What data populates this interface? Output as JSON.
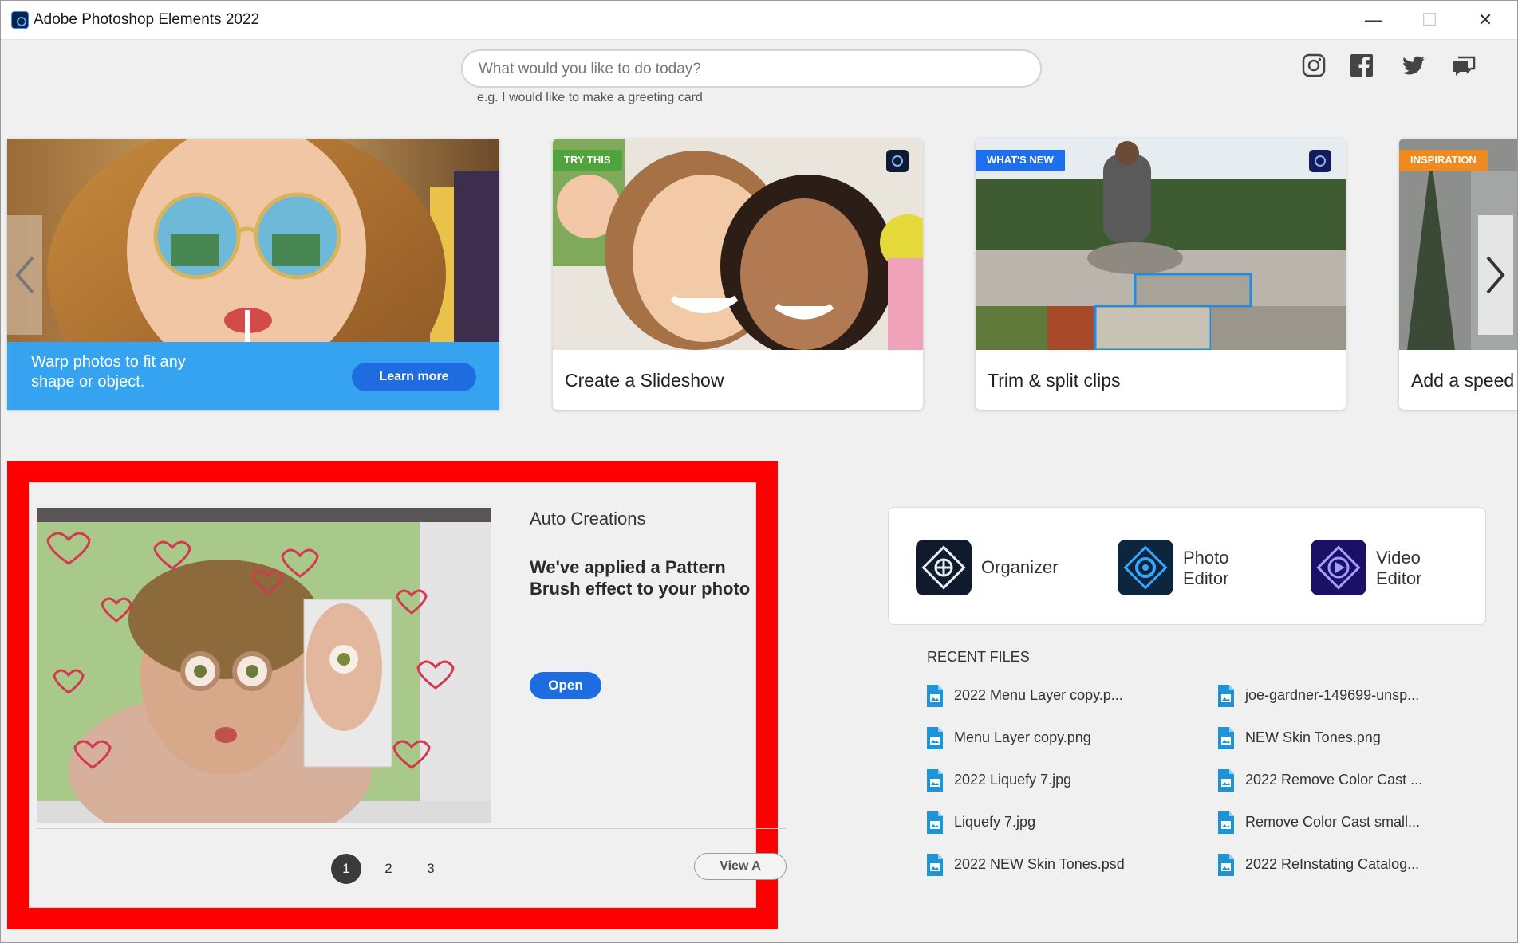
{
  "window": {
    "title": "Adobe Photoshop Elements 2022",
    "minimize": "—",
    "maximize": "☐",
    "close": "✕"
  },
  "search": {
    "placeholder": "What would you like to do today?",
    "hint": "e.g. I would like to make a greeting card"
  },
  "social": [
    "instagram-icon",
    "facebook-icon",
    "twitter-icon",
    "feedback-icon"
  ],
  "carousel": {
    "hero": {
      "text": "Warp photos to fit any shape or object.",
      "button": "Learn more"
    },
    "cards": [
      {
        "tag": "TRY THIS",
        "label": "Create a Slideshow"
      },
      {
        "tag": "WHAT'S NEW",
        "label": "Trim & split clips"
      },
      {
        "tag": "INSPIRATION",
        "label": "Add a speed e"
      }
    ]
  },
  "auto_creations": {
    "section": "Auto Creations",
    "description": "We've applied a Pattern Brush effect to your photo",
    "open": "Open",
    "pages": [
      "1",
      "2",
      "3"
    ],
    "active_page": "1",
    "view_all": "View A"
  },
  "launchers": [
    {
      "label": "Organizer"
    },
    {
      "label_line1": "Photo",
      "label_line2": "Editor"
    },
    {
      "label_line1": "Video",
      "label_line2": "Editor"
    }
  ],
  "recent": {
    "title": "RECENT FILES",
    "files": [
      "2022 Menu Layer copy.p...",
      "joe-gardner-149699-unsp...",
      "Menu Layer copy.png",
      "NEW Skin Tones.png",
      "2022 Liquefy 7.jpg",
      "2022 Remove Color Cast ...",
      "Liquefy 7.jpg",
      "Remove Color Cast small...",
      "2022 NEW Skin Tones.psd",
      "2022 ReInstating Catalog..."
    ]
  },
  "colors": {
    "accent": "#1e6de0",
    "hero_band": "#35a3f0",
    "highlight": "#ff0000",
    "tag_try": "#4fa43c",
    "tag_new": "#1e6ef0",
    "tag_inspiration": "#f08a1e"
  }
}
